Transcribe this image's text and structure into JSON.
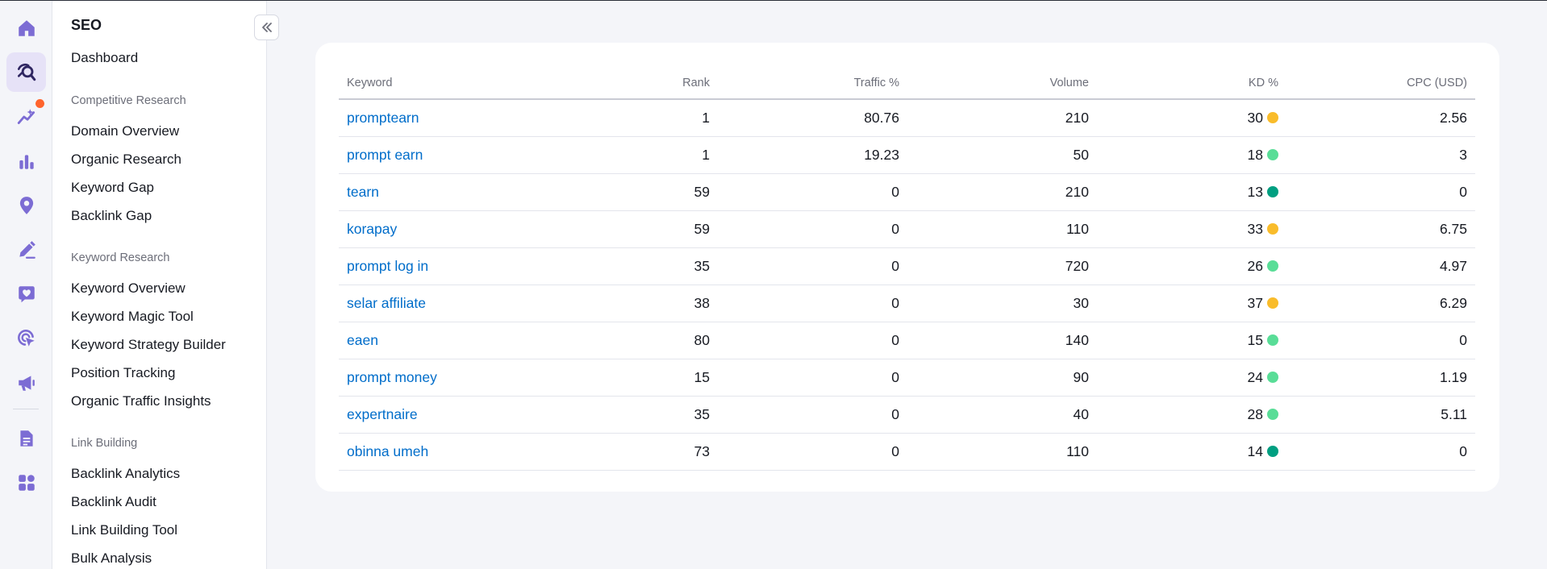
{
  "colors": {
    "accent": "#7c6cd4",
    "link": "#006dca",
    "notification": "#ff642d",
    "kd_medium": "#f9bc2b",
    "kd_easy": "#59dd97",
    "kd_very_easy": "#009f81"
  },
  "rail": {
    "icons": [
      "home-icon",
      "seo-icon",
      "trends-icon",
      "chart-bars-icon",
      "location-pin-icon",
      "pen-icon",
      "heart-chat-icon",
      "target-cursor-icon",
      "megaphone-icon",
      "document-icon",
      "apps-grid-icon"
    ],
    "active": "seo-icon"
  },
  "menu": {
    "title": "SEO",
    "dashboard": "Dashboard",
    "sections": [
      {
        "label": "Competitive Research",
        "items": [
          "Domain Overview",
          "Organic Research",
          "Keyword Gap",
          "Backlink Gap"
        ]
      },
      {
        "label": "Keyword Research",
        "items": [
          "Keyword Overview",
          "Keyword Magic Tool",
          "Keyword Strategy Builder",
          "Position Tracking",
          "Organic Traffic Insights"
        ]
      },
      {
        "label": "Link Building",
        "items": [
          "Backlink Analytics",
          "Backlink Audit",
          "Link Building Tool",
          "Bulk Analysis"
        ]
      }
    ]
  },
  "table": {
    "columns": [
      "Keyword",
      "Rank",
      "Traffic %",
      "Volume",
      "KD %",
      "CPC (USD)"
    ],
    "rows": [
      {
        "keyword": "promptearn",
        "rank": "1",
        "traffic": "80.76",
        "volume": "210",
        "kd": "30",
        "kd_color": "#f9bc2b",
        "cpc": "2.56"
      },
      {
        "keyword": "prompt earn",
        "rank": "1",
        "traffic": "19.23",
        "volume": "50",
        "kd": "18",
        "kd_color": "#59dd97",
        "cpc": "3"
      },
      {
        "keyword": "tearn",
        "rank": "59",
        "traffic": "0",
        "volume": "210",
        "kd": "13",
        "kd_color": "#009f81",
        "cpc": "0"
      },
      {
        "keyword": "korapay",
        "rank": "59",
        "traffic": "0",
        "volume": "110",
        "kd": "33",
        "kd_color": "#f9bc2b",
        "cpc": "6.75"
      },
      {
        "keyword": "prompt log in",
        "rank": "35",
        "traffic": "0",
        "volume": "720",
        "kd": "26",
        "kd_color": "#59dd97",
        "cpc": "4.97"
      },
      {
        "keyword": "selar affiliate",
        "rank": "38",
        "traffic": "0",
        "volume": "30",
        "kd": "37",
        "kd_color": "#f9bc2b",
        "cpc": "6.29"
      },
      {
        "keyword": "eaen",
        "rank": "80",
        "traffic": "0",
        "volume": "140",
        "kd": "15",
        "kd_color": "#59dd97",
        "cpc": "0"
      },
      {
        "keyword": "prompt money",
        "rank": "15",
        "traffic": "0",
        "volume": "90",
        "kd": "24",
        "kd_color": "#59dd97",
        "cpc": "1.19"
      },
      {
        "keyword": "expertnaire",
        "rank": "35",
        "traffic": "0",
        "volume": "40",
        "kd": "28",
        "kd_color": "#59dd97",
        "cpc": "5.11"
      },
      {
        "keyword": "obinna umeh",
        "rank": "73",
        "traffic": "0",
        "volume": "110",
        "kd": "14",
        "kd_color": "#009f81",
        "cpc": "0"
      }
    ]
  }
}
